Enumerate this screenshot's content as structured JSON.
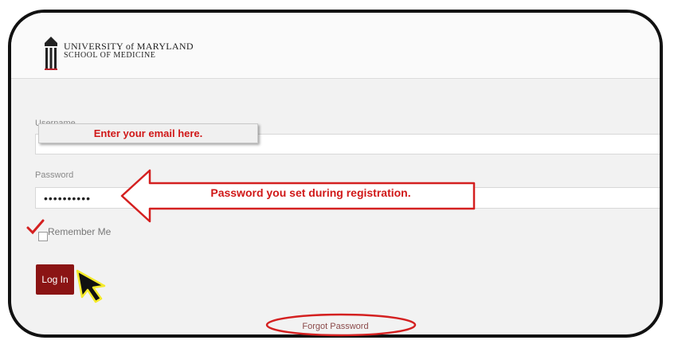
{
  "header": {
    "logo_line1": "UNIVERSITY of MARYLAND",
    "logo_line2": "SCHOOL OF MEDICINE"
  },
  "login_form": {
    "username_label": "Username",
    "username_hint": "Enter your email here.",
    "password_label": "Password",
    "password_value": "••••••••••",
    "password_hint": "Password you set during registration.",
    "remember_label": "Remember Me",
    "remember_checked": true,
    "login_button": "Log In",
    "forgot_link": "Forgot Password"
  },
  "colors": {
    "brand_red": "#8b1414",
    "annotation_red": "#d01818",
    "cursor_yellow": "#f5ea2a"
  },
  "icons": [
    "university-logo-icon",
    "checkmark-icon",
    "arrow-left-icon",
    "cursor-icon"
  ]
}
